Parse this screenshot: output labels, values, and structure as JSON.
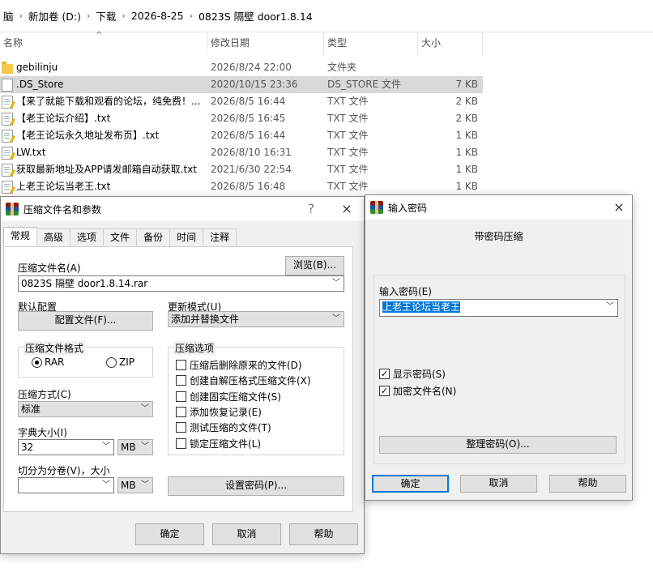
{
  "explorer": {
    "breadcrumb": [
      "脑",
      "新加卷 (D:)",
      "下载",
      "2026-8-25",
      "0823S 隔壁 door1.8.14"
    ],
    "columns": {
      "name": "名称",
      "date": "修改日期",
      "type": "类型",
      "size": "大小"
    },
    "files": [
      {
        "name": "gebilinju",
        "date": "2026/8/24 22:00",
        "type": "文件夹",
        "size": "",
        "icon": "folder"
      },
      {
        "name": ".DS_Store",
        "date": "2020/10/15 23:36",
        "type": "DS_STORE 文件",
        "size": "7 KB",
        "icon": "blank-file"
      },
      {
        "name": "【来了就能下载和观看的论坛，纯免费！...",
        "date": "2026/8/5 16:44",
        "type": "TXT 文件",
        "size": "2 KB",
        "icon": "text-file"
      },
      {
        "name": "【老王论坛介绍】.txt",
        "date": "2026/8/5 16:45",
        "type": "TXT 文件",
        "size": "2 KB",
        "icon": "text-file"
      },
      {
        "name": "【老王论坛永久地址发布页】.txt",
        "date": "2026/8/5 16:44",
        "type": "TXT 文件",
        "size": "1 KB",
        "icon": "text-file"
      },
      {
        "name": "LW.txt",
        "date": "2026/8/10 16:31",
        "type": "TXT 文件",
        "size": "1 KB",
        "icon": "text-file"
      },
      {
        "name": "获取最新地址及APP请发邮箱自动获取.txt",
        "date": "2021/6/30 22:54",
        "type": "TXT 文件",
        "size": "1 KB",
        "icon": "text-file"
      },
      {
        "name": "上老王论坛当老王.txt",
        "date": "2026/8/5 16:48",
        "type": "TXT 文件",
        "size": "1 KB",
        "icon": "text-file"
      }
    ]
  },
  "archive_dialog": {
    "title": "压缩文件名和参数",
    "help": "?",
    "close": "×",
    "tabs": [
      "常规",
      "高级",
      "选项",
      "文件",
      "备份",
      "时间",
      "注释"
    ],
    "archive_name_label": "压缩文件名(A)",
    "browse": "浏览(B)...",
    "archive_name_value": "0823S 隔壁 door1.8.14.rar",
    "default_profile_label": "默认配置",
    "profiles_button": "配置文件(F)...",
    "update_mode_label": "更新模式(U)",
    "update_mode_value": "添加并替换文件",
    "format_group": "压缩文件格式",
    "format_rar": "RAR",
    "format_zip": "ZIP",
    "options_group": "压缩选项",
    "options": [
      {
        "label": "压缩后删除原来的文件(D)",
        "checked": false
      },
      {
        "label": "创建自解压格式压缩文件(X)",
        "checked": false
      },
      {
        "label": "创建固实压缩文件(S)",
        "checked": false
      },
      {
        "label": "添加恢复记录(E)",
        "checked": false
      },
      {
        "label": "测试压缩的文件(T)",
        "checked": false
      },
      {
        "label": "锁定压缩文件(L)",
        "checked": false
      }
    ],
    "method_label": "压缩方式(C)",
    "method_value": "标准",
    "dict_label": "字典大小(I)",
    "dict_value": "32",
    "dict_unit": "MB",
    "split_label": "切分为分卷(V)，大小",
    "split_value": "",
    "split_unit": "MB",
    "set_password": "设置密码(P)...",
    "ok": "确定",
    "cancel": "取消",
    "help_button": "帮助"
  },
  "password_dialog": {
    "title": "输入密码",
    "close": "×",
    "heading": "带密码压缩",
    "input_label": "输入密码(E)",
    "password_value": "上老王论坛当老王",
    "show_password": "显示密码(S)",
    "encrypt_names": "加密文件名(N)",
    "organize": "整理密码(O)...",
    "ok": "确定",
    "cancel": "取消",
    "help_button": "帮助"
  }
}
